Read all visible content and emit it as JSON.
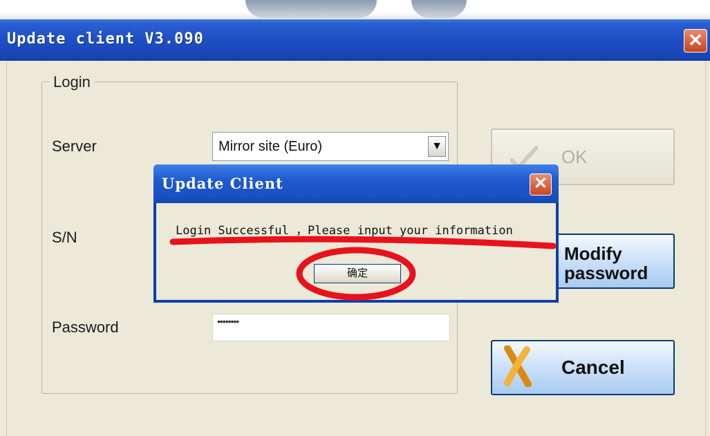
{
  "main_window": {
    "title": "Update client V3.090",
    "close_symbol": "✕"
  },
  "login_group": {
    "legend": "Login",
    "server_label": "Server",
    "server_value": "Mirror site (Euro)",
    "sn_label": "S/N",
    "password_label": "Password",
    "password_mask": "••••••••"
  },
  "buttons": {
    "ok_label": "OK",
    "modify_password_line1": "Modify",
    "modify_password_line2": "password",
    "cancel_label": "Cancel"
  },
  "dialog": {
    "title": "Update Client",
    "close_symbol": "✕",
    "message": "Login Successful ，Please input your information",
    "confirm_label": "确定"
  },
  "colors": {
    "titlebar_blue": "#1d4fc4",
    "window_bg": "#ece9d8",
    "annotation_red": "#e8121c"
  },
  "icons": {
    "close": "close-icon",
    "dropdown": "chevron-down-icon",
    "ok": "checkmark-icon",
    "cancel": "cancel-x-icon"
  }
}
